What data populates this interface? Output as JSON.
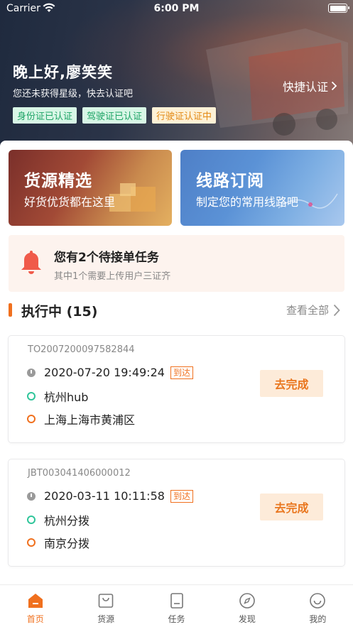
{
  "status_bar": {
    "carrier": "Carrier",
    "time": "6:00 PM"
  },
  "header": {
    "greeting": "晚上好,廖笑笑",
    "subtitle": "您还未获得星级，快去认证吧",
    "quick_auth": "快捷认证",
    "tags": [
      {
        "label": "身份证已认证",
        "status": "ok"
      },
      {
        "label": "驾驶证已认证",
        "status": "ok"
      },
      {
        "label": "行驶证认证中",
        "status": "pending"
      }
    ]
  },
  "banners": [
    {
      "title": "货源精选",
      "subtitle": "好货优货都在这里"
    },
    {
      "title": "线路订阅",
      "subtitle": "制定您的常用线路吧"
    }
  ],
  "notice": {
    "title": "您有2个待接单任务",
    "subtitle": "其中1个需要上传用户三证齐"
  },
  "section": {
    "title": "执行中 (15)",
    "view_all": "查看全部"
  },
  "tasks": [
    {
      "order_no": "TO2007200097582844",
      "time": "2020-07-20 19:49:24",
      "badge": "到达",
      "from": "杭州hub",
      "to": "上海上海市黄浦区",
      "action": "去完成"
    },
    {
      "order_no": "JBT003041406000012",
      "time": "2020-03-11 10:11:58",
      "badge": "到达",
      "from": "杭州分拨",
      "to": "南京分拨",
      "action": "去完成"
    }
  ],
  "tabbar": [
    {
      "label": "首页",
      "icon": "home-icon",
      "active": true
    },
    {
      "label": "货源",
      "icon": "bag-icon",
      "active": false
    },
    {
      "label": "任务",
      "icon": "document-icon",
      "active": false
    },
    {
      "label": "发现",
      "icon": "compass-icon",
      "active": false
    },
    {
      "label": "我的",
      "icon": "smiley-icon",
      "active": false
    }
  ],
  "colors": {
    "accent": "#f0701e",
    "success": "#1ea466",
    "pending": "#e38a16"
  }
}
